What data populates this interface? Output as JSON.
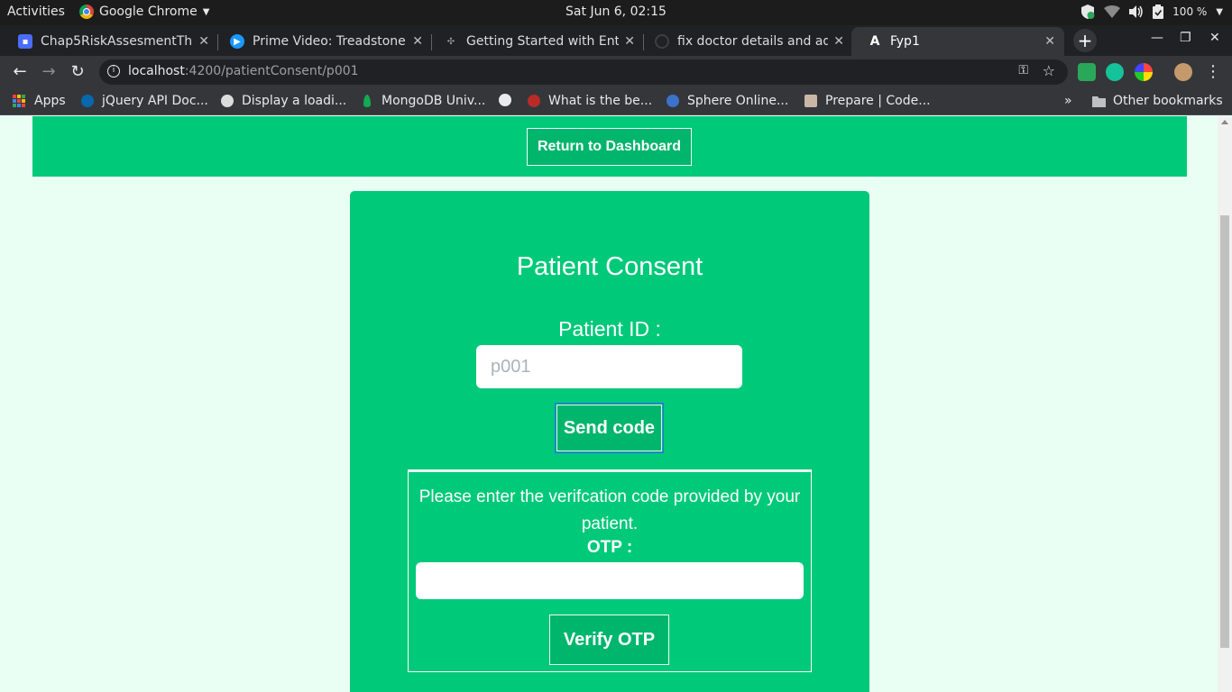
{
  "system_bar": {
    "activities": "Activities",
    "app_name": "Google Chrome",
    "clock": "Sat Jun  6, 02:15",
    "battery": "100 %"
  },
  "tabs": [
    {
      "title": "Chap5RiskAssesmentThr",
      "icon": "docs-icon",
      "icon_color": "#4a6cf7",
      "active": false
    },
    {
      "title": "Prime Video: Treadstone",
      "icon": "prime-video-icon",
      "icon_color": "#1a98ff",
      "active": false
    },
    {
      "title": "Getting Started with Ente",
      "icon": "site-icon",
      "icon_color": "#5f6368",
      "active": false
    },
    {
      "title": "fix doctor details and add",
      "icon": "github-icon",
      "icon_color": "#3c4043",
      "active": false
    },
    {
      "title": "Fyp1",
      "icon": "angular-icon",
      "icon_color": "#35363a",
      "active": true
    }
  ],
  "address_bar": {
    "host": "localhost",
    "path": ":4200/patientConsent/p001"
  },
  "bookmarks": {
    "apps": "Apps",
    "items": [
      {
        "label": "jQuery API Doc...",
        "icon": "jquery-icon",
        "color": "#0769ad"
      },
      {
        "label": "Display a loadi...",
        "icon": "site-icon",
        "color": "#dcdcdc"
      },
      {
        "label": "MongoDB Univ...",
        "icon": "mongodb-leaf-icon",
        "color": "#13aa52"
      },
      {
        "label": "",
        "icon": "globe-icon",
        "color": "#e8eaed"
      },
      {
        "label": "What is the be...",
        "icon": "quora-icon",
        "color": "#b92b27"
      },
      {
        "label": "Sphere Online...",
        "icon": "spoj-icon",
        "color": "#3b73c8"
      },
      {
        "label": "Prepare | Code...",
        "icon": "codechef-icon",
        "color": "#c8b7a6"
      }
    ],
    "overflow": "»",
    "other": "Other bookmarks"
  },
  "page": {
    "return_button": "Return to Dashboard",
    "card_title": "Patient Consent",
    "patient_id_label": "Patient ID :",
    "patient_id_placeholder": "p001",
    "send_code_button": "Send code",
    "otp_message": "Please enter the verifcation code provided by your patient.",
    "otp_label": "OTP :",
    "otp_value": "",
    "verify_button": "Verify OTP"
  },
  "colors": {
    "page_bg": "#eafff4",
    "brand_green": "#00c979",
    "button_green": "#00b56c"
  }
}
